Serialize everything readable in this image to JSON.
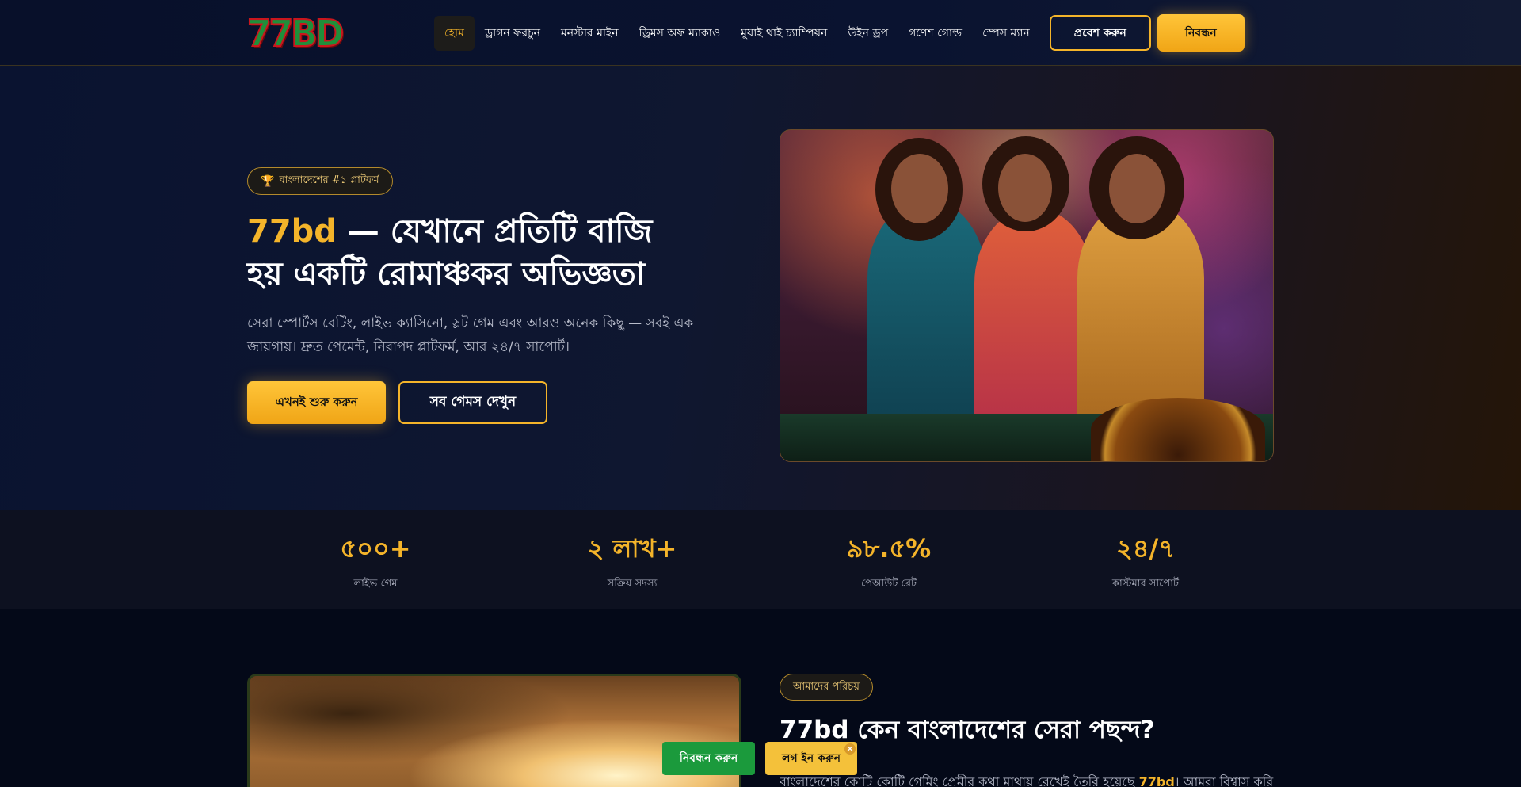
{
  "header": {
    "logo_text": "77BD",
    "nav": [
      "হোম",
      "ড্রাগন ফরচুন",
      "মনস্টার মাইন",
      "ড্রিমস অফ ম্যাকাও",
      "মুয়াই থাই চ্যাম্পিয়ন",
      "উইন ড্রপ",
      "গণেশ গোল্ড",
      "স্পেস ম্যান"
    ],
    "login_label": "প্রবেশ করুন",
    "register_label": "নিবন্ধন"
  },
  "hero": {
    "badge": "বাংলাদেশের #১ প্লাটফর্ম",
    "title_brand": "77bd",
    "title_rest": " — যেখানে প্রতিটি বাজি হয় একটি রোমাঞ্চকর অভিজ্ঞতা",
    "description": "সেরা স্পোর্টস বেটিং, লাইভ ক্যাসিনো, স্লট গেম এবং আরও অনেক কিছু — সবই এক জায়গায়। দ্রুত পেমেন্ট, নিরাপদ প্লাটফর্ম, আর ২৪/৭ সাপোর্ট।",
    "start_label": "এখনই শুরু করুন",
    "games_label": "সব গেমস দেখুন"
  },
  "stats": [
    {
      "value": "৫০০+",
      "label": "লাইভ গেম"
    },
    {
      "value": "২ লাখ+",
      "label": "সক্রিয় সদস্য"
    },
    {
      "value": "৯৮.৫%",
      "label": "পেআউট রেট"
    },
    {
      "value": "২৪/৭",
      "label": "কাস্টমার সাপোর্ট"
    }
  ],
  "about": {
    "badge": "আমাদের পরিচয়",
    "title": "77bd কেন বাংলাদেশের সেরা পছন্দ?",
    "text_before": "বাংলাদেশের কোটি কোটি গেমিং প্রেমীর কথা মাথায় রেখেই তৈরি হয়েছে ",
    "text_brand": "77bd",
    "text_after": "। আমরা বিশ্বাস করি"
  },
  "float_bar": {
    "register_label": "নিবন্ধন করুন",
    "login_label": "লগ ইন করুন",
    "close_symbol": "×"
  },
  "colors": {
    "accent": "#f4b42a",
    "background": "#050a1c",
    "register_green": "#1b9a3c"
  }
}
